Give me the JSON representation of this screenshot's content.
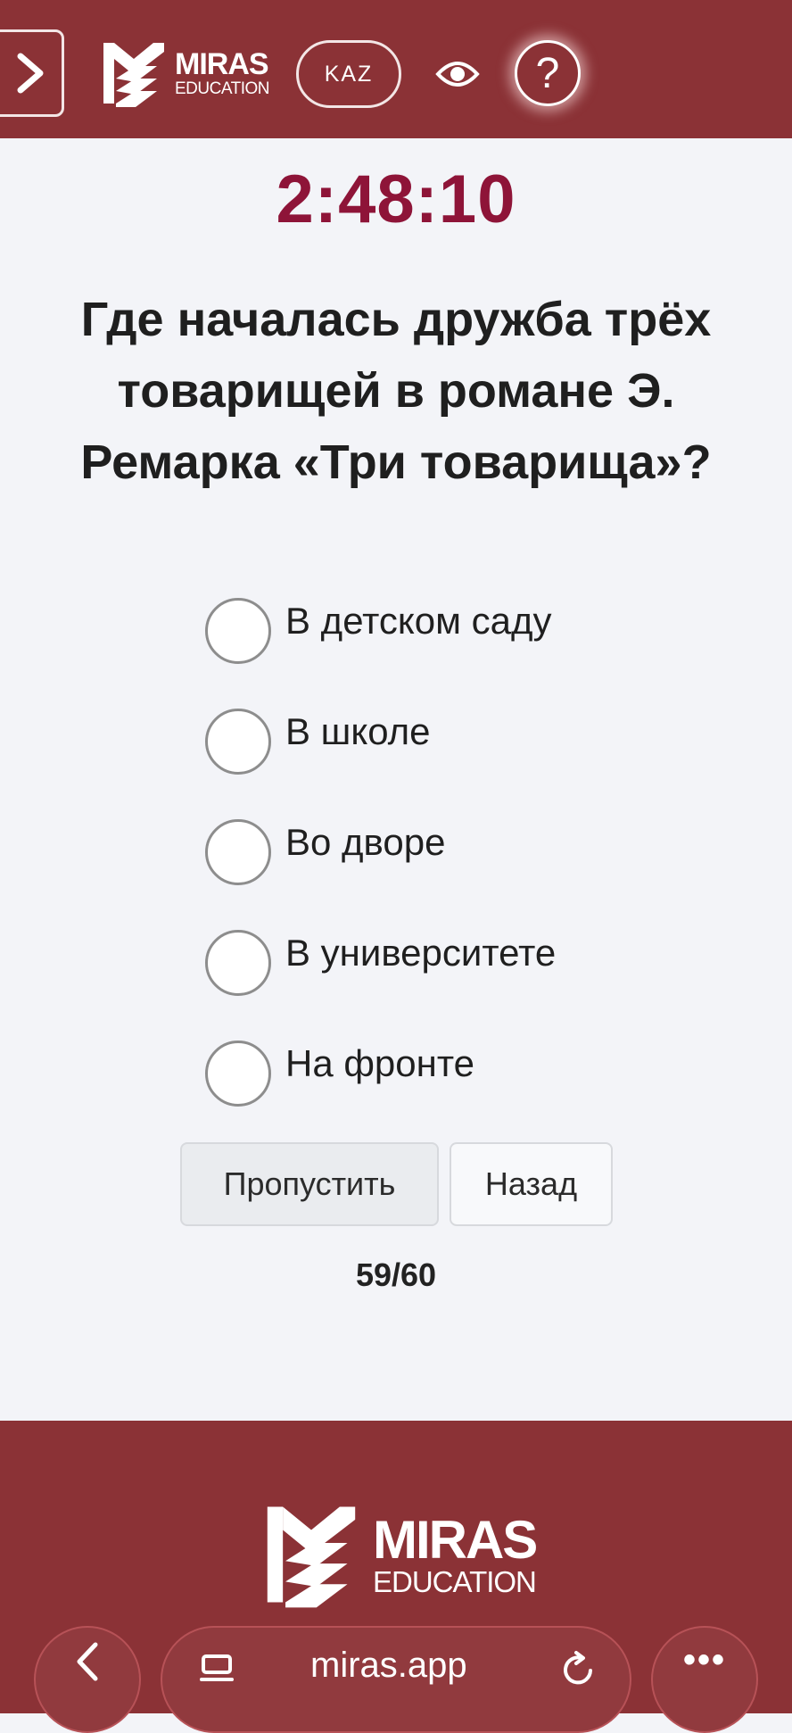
{
  "header": {
    "logo_top": "MIRAS",
    "logo_bottom": "EDUCATION",
    "language": "KAZ",
    "help_label": "?"
  },
  "quiz": {
    "timer": "2:48:10",
    "question": "Где началась дружба трёх товарищей в романе Э. Ремарка «Три товарища»?",
    "options": [
      "В детском саду",
      "В школе",
      "Во дворе",
      "В университете",
      "На фронте"
    ],
    "skip_label": "Пропустить",
    "back_label": "Назад",
    "progress": "59/60"
  },
  "footer": {
    "logo_top": "MIRAS",
    "logo_bottom": "EDUCATION"
  },
  "browser": {
    "url": "miras.app",
    "more_label": "•••"
  },
  "colors": {
    "brand": "#8b3236",
    "timer": "#8e1438",
    "background": "#f3f4f8"
  }
}
